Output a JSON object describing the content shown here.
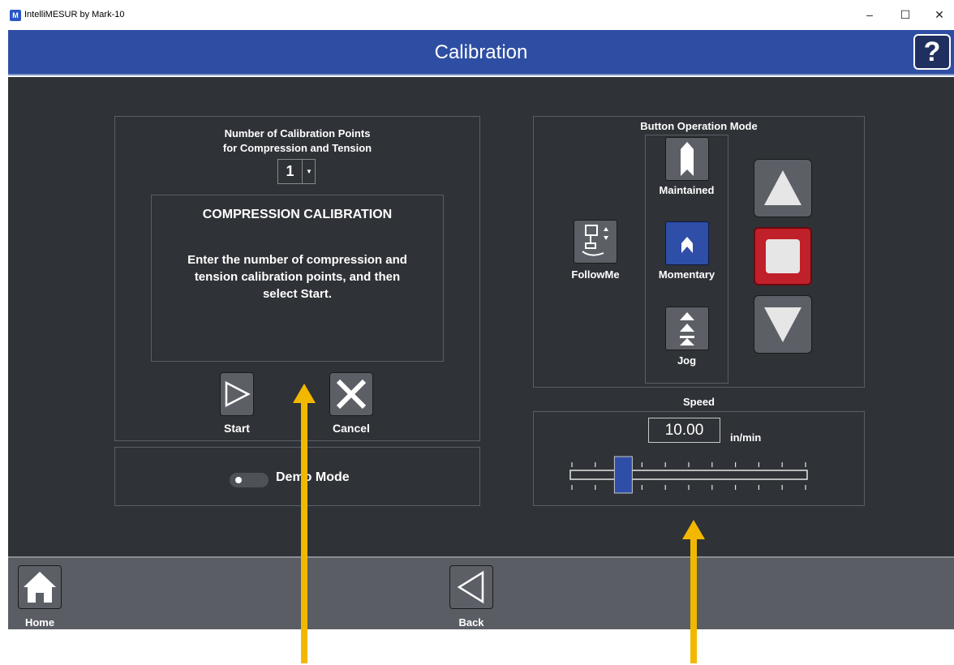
{
  "window": {
    "title": "IntelliMESUR by Mark-10",
    "minimize": "–",
    "maximize": "☐",
    "close": "✕"
  },
  "header": {
    "title": "Calibration",
    "help_label": "?"
  },
  "calibration": {
    "points_label_line1": "Number of Calibration Points",
    "points_label_line2": "for Compression and Tension",
    "points_value": "1",
    "box_title": "COMPRESSION CALIBRATION",
    "box_text_line1": "Enter the number of compression and",
    "box_text_line2": "tension calibration points, and then",
    "box_text_line3": "select Start.",
    "start_label": "Start",
    "cancel_label": "Cancel"
  },
  "demo": {
    "label": "Demo Mode",
    "enabled": false
  },
  "button_mode": {
    "title": "Button Operation Mode",
    "maintained_label": "Maintained",
    "momentary_label": "Momentary",
    "jog_label": "Jog",
    "followme_label": "FollowMe",
    "selected": "Momentary"
  },
  "speed": {
    "title": "Speed",
    "value": "10.00",
    "unit": "in/min",
    "slider_fraction": 0.22
  },
  "footer": {
    "home_label": "Home",
    "back_label": "Back"
  },
  "colors": {
    "header": "#2e4ea3",
    "main_bg": "#2f3236",
    "stop": "#c0202a",
    "selected": "#2f4ea8",
    "annotation": "#f2b800"
  }
}
